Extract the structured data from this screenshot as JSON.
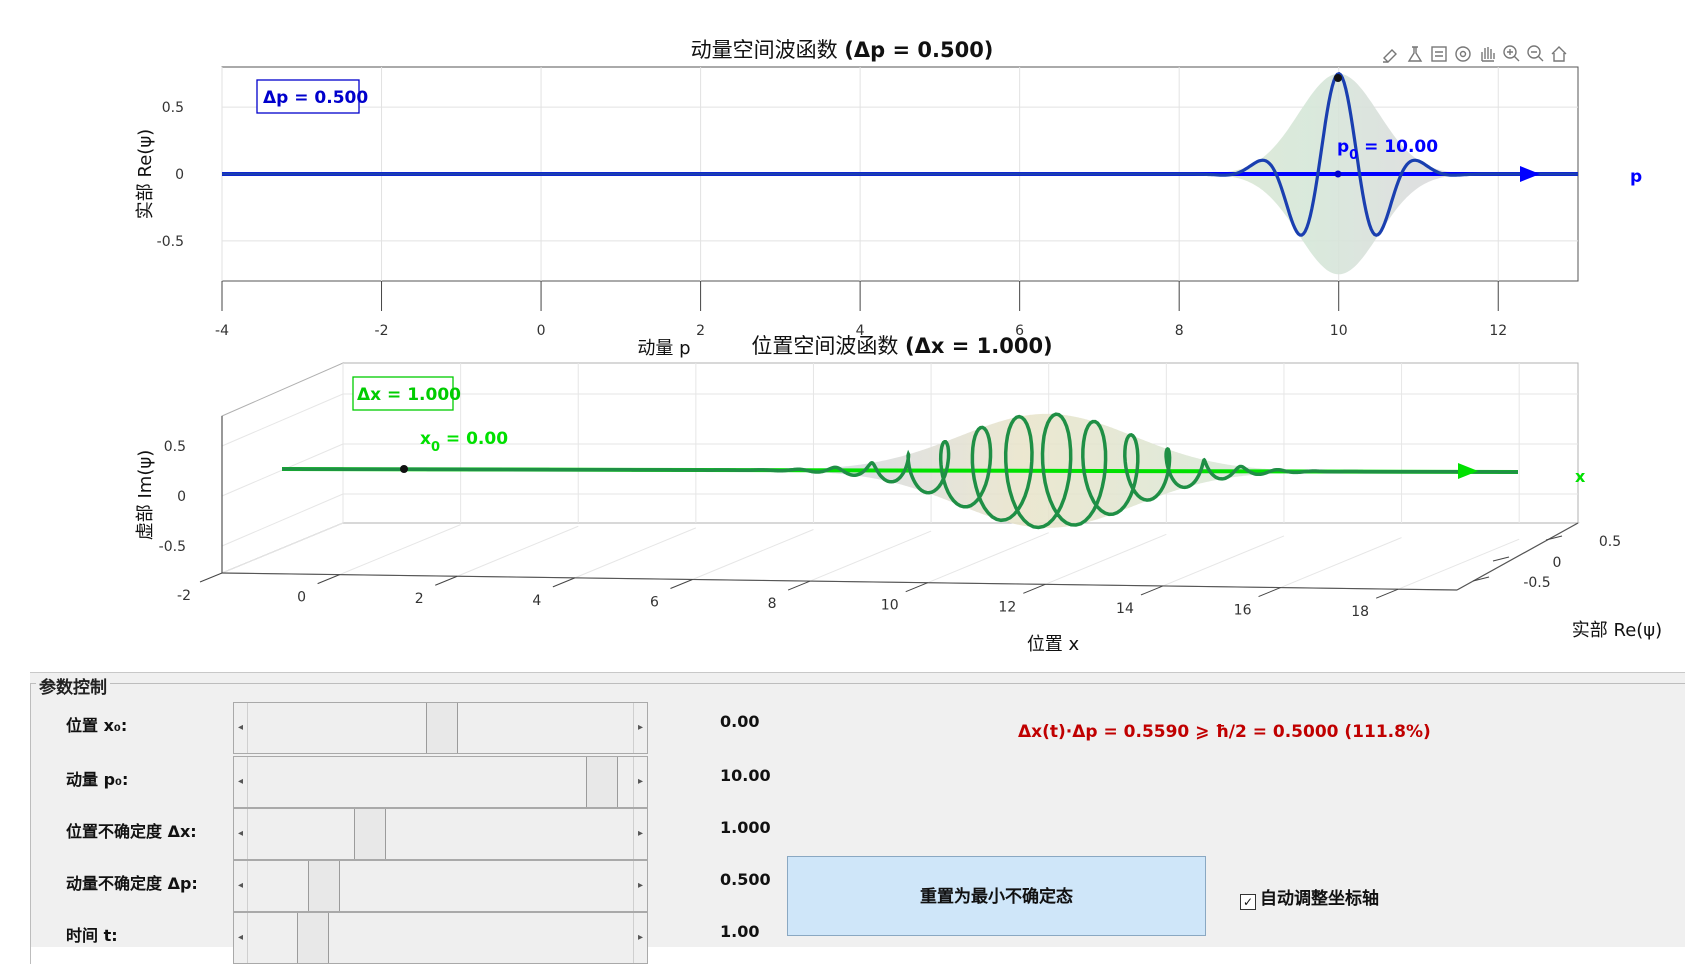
{
  "toolbar": {
    "icons": [
      "brush-icon",
      "flask-icon",
      "data-cursor-icon",
      "rotate-icon",
      "pan-icon",
      "zoom-in-icon",
      "zoom-out-icon",
      "home-icon"
    ]
  },
  "colors": {
    "blue": "#0000ff",
    "green": "#00e000",
    "darkgreen": "#1f8f45",
    "red": "#c00000"
  },
  "chart_data": [
    {
      "type": "line",
      "title_prefix": "动量空间波函数 ",
      "title_value": "(Δp = 0.500)",
      "xlabel": "动量 p",
      "ylabel": "实部 Re(ψ)",
      "axis_end_label": "p",
      "xlim": [
        -4,
        13
      ],
      "ylim": [
        -0.8,
        0.8
      ],
      "xticks": [
        -4,
        -2,
        0,
        2,
        4,
        6,
        8,
        10,
        12
      ],
      "yticks": [
        0.5,
        0,
        -0.5
      ],
      "ytick_labels": [
        "0.5",
        "0",
        "-0.5"
      ],
      "legend_box": "Δp = 0.500",
      "marker_label": "p",
      "marker_sub": "0",
      "marker_value": " = 10.00",
      "center": 10.0,
      "sigma": 0.5,
      "wave_frequency": 6,
      "peak": 0.75,
      "grid": true
    },
    {
      "type": "line",
      "title_prefix": "位置空间波函数 ",
      "title_value": "(Δx = 1.000)",
      "xlabel": "位置 x",
      "ylabel": "虚部 Im(ψ)",
      "zlabel": "实部 Re(ψ)",
      "axis_end_label": "x",
      "xlim": [
        -2,
        19
      ],
      "xticks": [
        -2,
        0,
        2,
        4,
        6,
        8,
        10,
        12,
        14,
        16,
        18
      ],
      "yticks": [
        0.5,
        0,
        -0.5
      ],
      "ytick_labels": [
        "0.5",
        "0",
        "-0.5"
      ],
      "zticks": [
        0.5,
        0,
        -0.5
      ],
      "ztick_labels": [
        "0.5",
        "0",
        "-0.5"
      ],
      "legend_box": "Δx = 1.000",
      "marker_label": "x",
      "marker_sub": "0",
      "marker_value": " = 0.00",
      "center": 11.0,
      "sigma": 1.0,
      "wave_frequency": 10,
      "peak": 0.6,
      "grid": true
    }
  ],
  "panel": {
    "title": "参数控制",
    "params": [
      {
        "label": "位置 x₀:",
        "value": "0.00",
        "position": 0.5
      },
      {
        "label": "动量 p₀:",
        "value": "10.00",
        "position": 0.95
      },
      {
        "label": "位置不确定度 Δx:",
        "value": "1.000",
        "position": 0.3
      },
      {
        "label": "动量不确定度 Δp:",
        "value": "0.500",
        "position": 0.17
      },
      {
        "label": "时间 t:",
        "value": "1.00",
        "position": 0.14
      }
    ],
    "uncertainty": "Δx(t)·Δp = 0.5590  ⩾  ħ/2 = 0.5000  (111.8%)",
    "reset_label": "重置为最小不确定态",
    "autoscale_label": "自动调整坐标轴",
    "autoscale_checked": true
  }
}
